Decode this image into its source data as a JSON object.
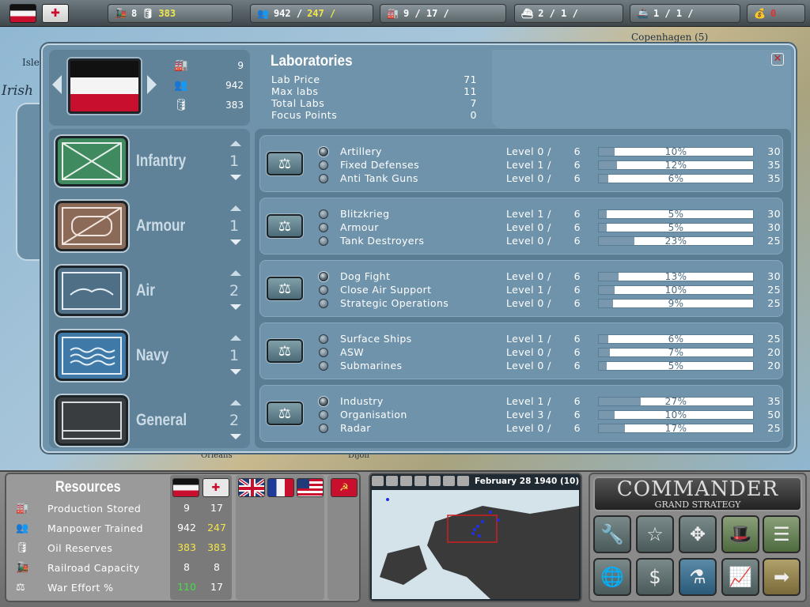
{
  "topbar": {
    "railroad": "8",
    "oil": "383",
    "manpower": "942 /",
    "manpower2": "247 /",
    "factories": "9 /  17 /",
    "ships": "2 /  1 /",
    "transports": "1 /  1 /",
    "money": "0"
  },
  "map": {
    "labels": [
      "Copenhagen (5)",
      "Irish",
      "Isle",
      "Orleans",
      "Dijon"
    ]
  },
  "country": {
    "production": "9",
    "manpower": "942",
    "oil": "383"
  },
  "labs": {
    "title": "Laboratories",
    "rows": [
      {
        "label": "Lab Price",
        "value": "71"
      },
      {
        "label": "Max labs",
        "value": "11"
      },
      {
        "label": "Total Labs",
        "value": "7"
      },
      {
        "label": "Focus Points",
        "value": "0"
      }
    ]
  },
  "categories": [
    {
      "name": "Infantry",
      "labs": "1"
    },
    {
      "name": "Armour",
      "labs": "1"
    },
    {
      "name": "Air",
      "labs": "2"
    },
    {
      "name": "Navy",
      "labs": "1"
    },
    {
      "name": "General",
      "labs": "2"
    }
  ],
  "tech_groups": [
    {
      "techs": [
        {
          "name": "Artillery",
          "level": "Level 0 /",
          "max": "6",
          "progress": 10,
          "pct": "10%",
          "cost": "30",
          "selected": true
        },
        {
          "name": "Fixed Defenses",
          "level": "Level 1 /",
          "max": "6",
          "progress": 12,
          "pct": "12%",
          "cost": "35",
          "selected": false
        },
        {
          "name": "Anti Tank Guns",
          "level": "Level 0 /",
          "max": "6",
          "progress": 6,
          "pct": "6%",
          "cost": "35",
          "selected": false
        }
      ]
    },
    {
      "techs": [
        {
          "name": "Blitzkrieg",
          "level": "Level 1 /",
          "max": "6",
          "progress": 5,
          "pct": "5%",
          "cost": "30",
          "selected": false
        },
        {
          "name": "Armour",
          "level": "Level 0 /",
          "max": "6",
          "progress": 5,
          "pct": "5%",
          "cost": "30",
          "selected": false
        },
        {
          "name": "Tank Destroyers",
          "level": "Level 0 /",
          "max": "6",
          "progress": 23,
          "pct": "23%",
          "cost": "25",
          "selected": false
        }
      ]
    },
    {
      "techs": [
        {
          "name": "Dog Fight",
          "level": "Level 0 /",
          "max": "6",
          "progress": 13,
          "pct": "13%",
          "cost": "30",
          "selected": true
        },
        {
          "name": "Close Air Support",
          "level": "Level 1 /",
          "max": "6",
          "progress": 10,
          "pct": "10%",
          "cost": "25",
          "selected": false
        },
        {
          "name": "Strategic Operations",
          "level": "Level 0 /",
          "max": "6",
          "progress": 9,
          "pct": "9%",
          "cost": "25",
          "selected": false
        }
      ]
    },
    {
      "techs": [
        {
          "name": "Surface Ships",
          "level": "Level 1 /",
          "max": "6",
          "progress": 6,
          "pct": "6%",
          "cost": "25",
          "selected": false
        },
        {
          "name": "ASW",
          "level": "Level 0 /",
          "max": "6",
          "progress": 7,
          "pct": "7%",
          "cost": "20",
          "selected": false
        },
        {
          "name": "Submarines",
          "level": "Level 0 /",
          "max": "6",
          "progress": 5,
          "pct": "5%",
          "cost": "20",
          "selected": false
        }
      ]
    },
    {
      "techs": [
        {
          "name": "Industry",
          "level": "Level 1 /",
          "max": "6",
          "progress": 27,
          "pct": "27%",
          "cost": "35",
          "selected": true
        },
        {
          "name": "Organisation",
          "level": "Level 3 /",
          "max": "6",
          "progress": 10,
          "pct": "10%",
          "cost": "50",
          "selected": false
        },
        {
          "name": "Radar",
          "level": "Level 0 /",
          "max": "6",
          "progress": 17,
          "pct": "17%",
          "cost": "25",
          "selected": false
        }
      ]
    }
  ],
  "resources": {
    "title": "Resources",
    "rows": [
      {
        "label": "Production Stored",
        "de": "9",
        "it": "17"
      },
      {
        "label": "Manpower Trained",
        "de": "942",
        "it": "247"
      },
      {
        "label": "Oil Reserves",
        "de": "383",
        "it": "383"
      },
      {
        "label": "Railroad Capacity",
        "de": "8",
        "it": "8"
      },
      {
        "label": "War Effort %",
        "de": "110",
        "it": "17"
      }
    ]
  },
  "minimap": {
    "date": "February 28 1940 (10)"
  },
  "commander": {
    "title": "COMMANDER",
    "subtitle": "GRAND STRATEGY"
  },
  "colors": {
    "panel": "#6f93ab",
    "highlight_yellow": "#f2e64a",
    "highlight_green": "#43e043",
    "money_red": "#e03030"
  }
}
